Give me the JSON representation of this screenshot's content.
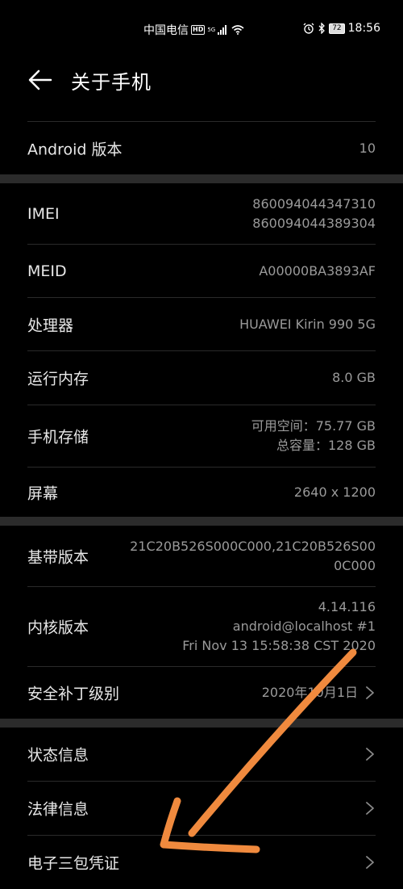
{
  "status_bar": {
    "carrier": "中国电信",
    "hd": "HD",
    "network": "5G",
    "battery": "72",
    "time": "18:56"
  },
  "header": {
    "title": "关于手机"
  },
  "rows": [
    {
      "label": "Android 版本",
      "value": "10"
    },
    {
      "label": "IMEI",
      "value_lines": [
        "860094044347310",
        "860094044389304"
      ]
    },
    {
      "label": "MEID",
      "value": "A00000BA3893AF"
    },
    {
      "label": "处理器",
      "value": "HUAWEI Kirin 990 5G"
    },
    {
      "label": "运行内存",
      "value": "8.0 GB"
    },
    {
      "label": "手机存储",
      "value_lines": [
        "可用空间：75.77  GB",
        "总容量：128  GB"
      ]
    },
    {
      "label": "屏幕",
      "value": "2640 x 1200"
    },
    {
      "label": "基带版本",
      "value_lines": [
        "21C20B526S000C000,21C20B526S00",
        "0C000"
      ]
    },
    {
      "label": "内核版本",
      "value_lines": [
        "4.14.116",
        "android@localhost #1",
        "Fri Nov 13 15:58:38 CST 2020"
      ]
    },
    {
      "label": "安全补丁级别",
      "value": "2020年10月1日"
    },
    {
      "label": "状态信息"
    },
    {
      "label": "法律信息"
    },
    {
      "label": "电子三包凭证"
    }
  ],
  "icons": {
    "back": "back-arrow-icon",
    "chevron": "chevron-right-icon"
  },
  "colors": {
    "background": "#000000",
    "section_divider": "#2b2b2b",
    "annotation_arrow": "#f08a3e"
  }
}
